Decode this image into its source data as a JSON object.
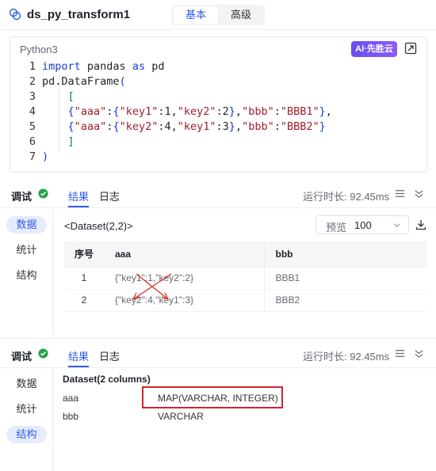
{
  "header": {
    "title": "ds_py_transform1",
    "tabs": [
      "基本",
      "高级"
    ]
  },
  "editor": {
    "language": "Python3",
    "ai_badge": "AI·先胜云",
    "line_numbers": [
      "1",
      "2",
      "3",
      "4",
      "5",
      "6",
      "7"
    ]
  },
  "panel1": {
    "debug": "调试",
    "tabs": [
      "结果",
      "日志"
    ],
    "runtime_label": "运行时长:",
    "runtime_value": "92.45ms",
    "side": [
      "数据",
      "统计",
      "结构"
    ],
    "dataset_title": "<Dataset(2,2)>",
    "preview_label": "预览",
    "preview_value": "100",
    "table": {
      "headers": [
        "序号",
        "aaa",
        "bbb"
      ],
      "rows": [
        [
          "1",
          "{\"key1\":1,\"key2\":2}",
          "BBB1"
        ],
        [
          "2",
          "{\"key2\":4,\"key1\":3}",
          "BBB2"
        ]
      ]
    }
  },
  "panel2": {
    "debug": "调试",
    "tabs": [
      "结果",
      "日志"
    ],
    "runtime_label": "运行时长:",
    "runtime_value": "92.45ms",
    "side": [
      "数据",
      "统计",
      "结构"
    ],
    "columns_title": "Dataset(2 columns)",
    "columns": [
      {
        "name": "aaa",
        "type": "MAP(VARCHAR, INTEGER)"
      },
      {
        "name": "bbb",
        "type": "VARCHAR"
      }
    ]
  },
  "colors": {
    "accent": "#2f5bea",
    "success": "#23a34a",
    "highlight": "#d0252e",
    "arrow": "#d9302e"
  }
}
